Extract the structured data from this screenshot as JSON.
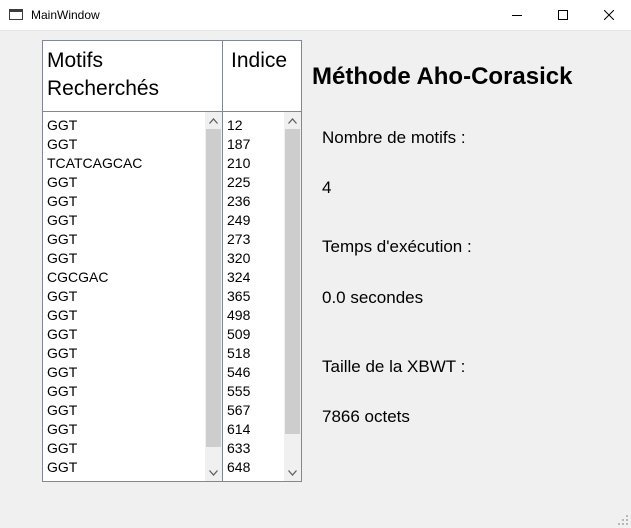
{
  "window": {
    "title": "MainWindow",
    "icons": {
      "app": "window-icon",
      "minimize": "minimize-icon",
      "maximize": "maximize-icon",
      "close": "close-icon"
    }
  },
  "table": {
    "headers": {
      "motifs": "Motifs\nRecherchés",
      "indice": "Indice"
    },
    "motifs": [
      "GGT",
      "GGT",
      "TCATCAGCAC",
      "GGT",
      "GGT",
      "GGT",
      "GGT",
      "GGT",
      "CGCGAC",
      "GGT",
      "GGT",
      "GGT",
      "GGT",
      "GGT",
      "GGT",
      "GGT",
      "GGT",
      "GGT",
      "GGT"
    ],
    "indices": [
      "12",
      "187",
      "210",
      "225",
      "236",
      "249",
      "273",
      "320",
      "324",
      "365",
      "498",
      "509",
      "518",
      "546",
      "555",
      "567",
      "614",
      "633",
      "648"
    ]
  },
  "info": {
    "title": "Méthode Aho-Corasick",
    "nombre_label": "Nombre de motifs :",
    "nombre_value": "4",
    "temps_label": "Temps d'exécution :",
    "temps_value": "0.0 secondes",
    "taille_label": "Taille de la XBWT :",
    "taille_value": "7866 octets"
  },
  "colors": {
    "background": "#f0f0f0",
    "border": "#828790",
    "scroll_thumb": "#cdcdcd"
  }
}
